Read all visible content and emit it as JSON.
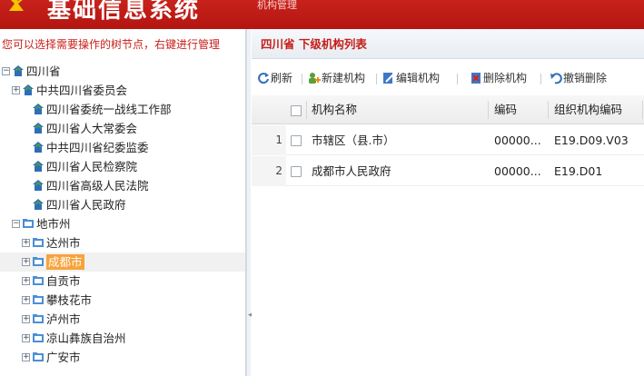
{
  "header": {
    "app_title": "基础信息系统",
    "tab": "机构管理",
    "brand_color": "#c51d18"
  },
  "left_panel": {
    "hint": "您可以选择需要操作的树节点，右键进行管理",
    "tree": [
      {
        "label": "四川省",
        "level": 0,
        "expander": "minus",
        "icon": "org-tree-icon"
      },
      {
        "label": "中共四川省委员会",
        "level": 1,
        "expander": "plus",
        "icon": "org-tree-icon"
      },
      {
        "label": "四川省委统一战线工作部",
        "level": 2,
        "expander": "",
        "icon": "org-tree-icon"
      },
      {
        "label": "四川省人大常委会",
        "level": 2,
        "expander": "",
        "icon": "org-tree-icon"
      },
      {
        "label": "中共四川省纪委监委",
        "level": 2,
        "expander": "",
        "icon": "org-tree-icon"
      },
      {
        "label": "四川省人民检察院",
        "level": 2,
        "expander": "",
        "icon": "org-tree-icon"
      },
      {
        "label": "四川省高级人民法院",
        "level": 2,
        "expander": "",
        "icon": "org-tree-icon"
      },
      {
        "label": "四川省人民政府",
        "level": 2,
        "expander": "",
        "icon": "org-tree-icon"
      },
      {
        "label": "地市州",
        "level": 1,
        "expander": "minus",
        "icon": "folder-icon"
      },
      {
        "label": "达州市",
        "level": 2,
        "expander": "plus",
        "icon": "folder-icon"
      },
      {
        "label": "成都市",
        "level": 2,
        "expander": "plus",
        "icon": "folder-icon",
        "selected": true
      },
      {
        "label": "自贡市",
        "level": 2,
        "expander": "plus",
        "icon": "folder-icon"
      },
      {
        "label": "攀枝花市",
        "level": 2,
        "expander": "plus",
        "icon": "folder-icon"
      },
      {
        "label": "泸州市",
        "level": 2,
        "expander": "plus",
        "icon": "folder-icon"
      },
      {
        "label": "凉山彝族自治州",
        "level": 2,
        "expander": "plus",
        "icon": "folder-icon"
      },
      {
        "label": "广安市",
        "level": 2,
        "expander": "plus",
        "icon": "folder-icon"
      }
    ]
  },
  "right_panel": {
    "title": "四川省 下级机构列表",
    "toolbar": [
      {
        "label": "刷新",
        "icon": "refresh-icon",
        "name": "refresh-button"
      },
      {
        "label": "新建机构",
        "icon": "new-org-icon",
        "name": "new-org-button"
      },
      {
        "label": "编辑机构",
        "icon": "edit-icon",
        "name": "edit-org-button"
      },
      {
        "label": "删除机构",
        "icon": "delete-icon",
        "name": "delete-org-button"
      },
      {
        "label": "撤销删除",
        "icon": "undo-icon",
        "name": "undo-delete-button"
      }
    ],
    "grid": {
      "columns": [
        "机构名称",
        "编码",
        "组织机构编码"
      ],
      "rows": [
        {
          "num": "1",
          "name": "市辖区（县.市）",
          "code": "00000...",
          "org_code": "E19.D09.V03"
        },
        {
          "num": "2",
          "name": "成都市人民政府",
          "code": "00000...",
          "org_code": "E19.D01"
        }
      ]
    }
  }
}
